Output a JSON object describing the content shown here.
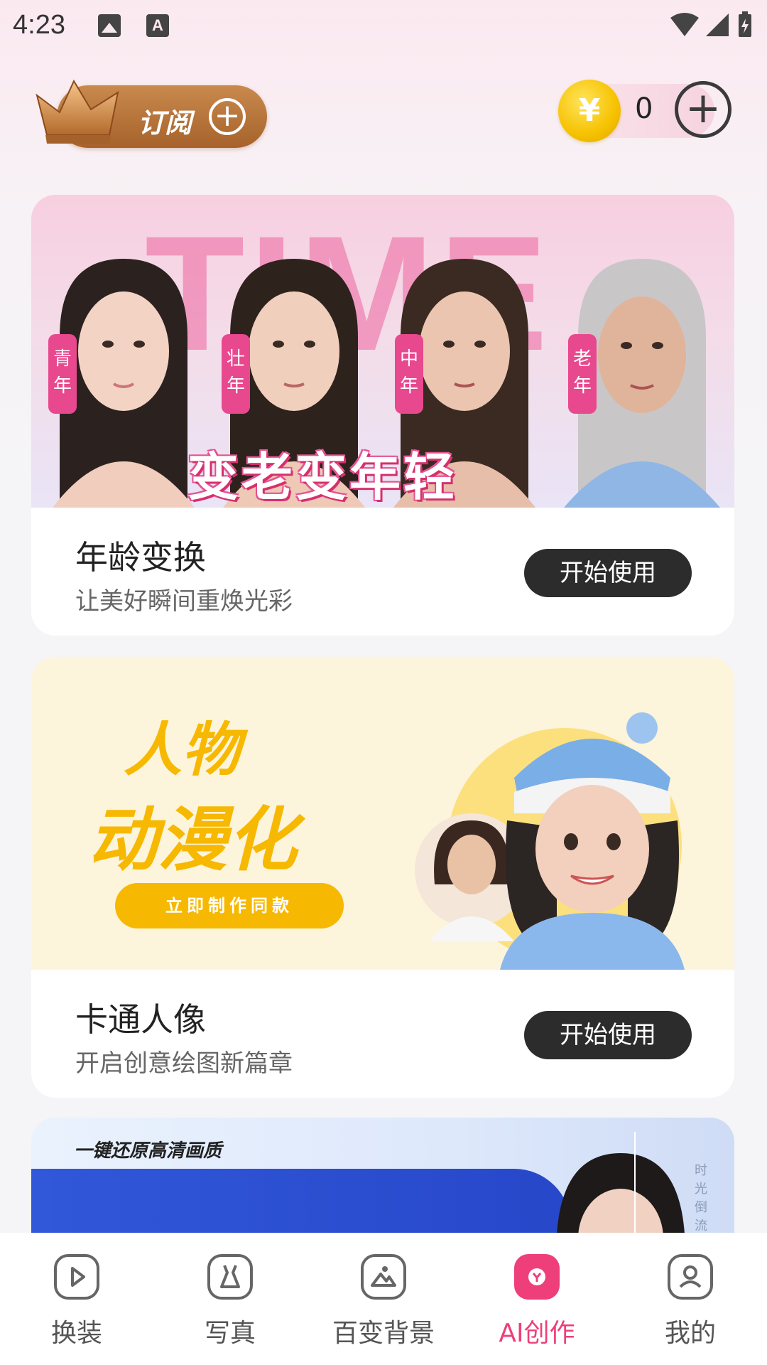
{
  "status_bar": {
    "time": "4:23",
    "indicator_a": "A"
  },
  "header": {
    "subscribe_label": "订阅",
    "coin_symbol": "¥",
    "coin_count": "0"
  },
  "cards": [
    {
      "banner": {
        "bg_text": "TIME",
        "tags": [
          "青年",
          "壮年",
          "中年",
          "老年"
        ],
        "slogan": "变老变年轻"
      },
      "title": "年龄变换",
      "subtitle": "让美好瞬间重焕光彩",
      "button": "开始使用"
    },
    {
      "banner": {
        "line1": "人物",
        "line2": "动漫化",
        "cta": "立即制作同款"
      },
      "title": "卡通人像",
      "subtitle": "开启创意绘图新篇章",
      "button": "开始使用"
    },
    {
      "banner": {
        "label": "一键还原高清画质",
        "side_text": "时光倒流"
      }
    }
  ],
  "bottom_nav": {
    "items": [
      {
        "label": "换装",
        "icon": "play-icon"
      },
      {
        "label": "写真",
        "icon": "dress-icon"
      },
      {
        "label": "百变背景",
        "icon": "landscape-icon"
      },
      {
        "label": "AI创作",
        "icon": "ai-icon"
      },
      {
        "label": "我的",
        "icon": "user-icon"
      }
    ],
    "active_index": 3,
    "active_color": "#ee3f7a"
  },
  "colors": {
    "accent_pink": "#ee3f7a",
    "gold": "#f6b800",
    "button_dark": "#2c2c2c"
  }
}
